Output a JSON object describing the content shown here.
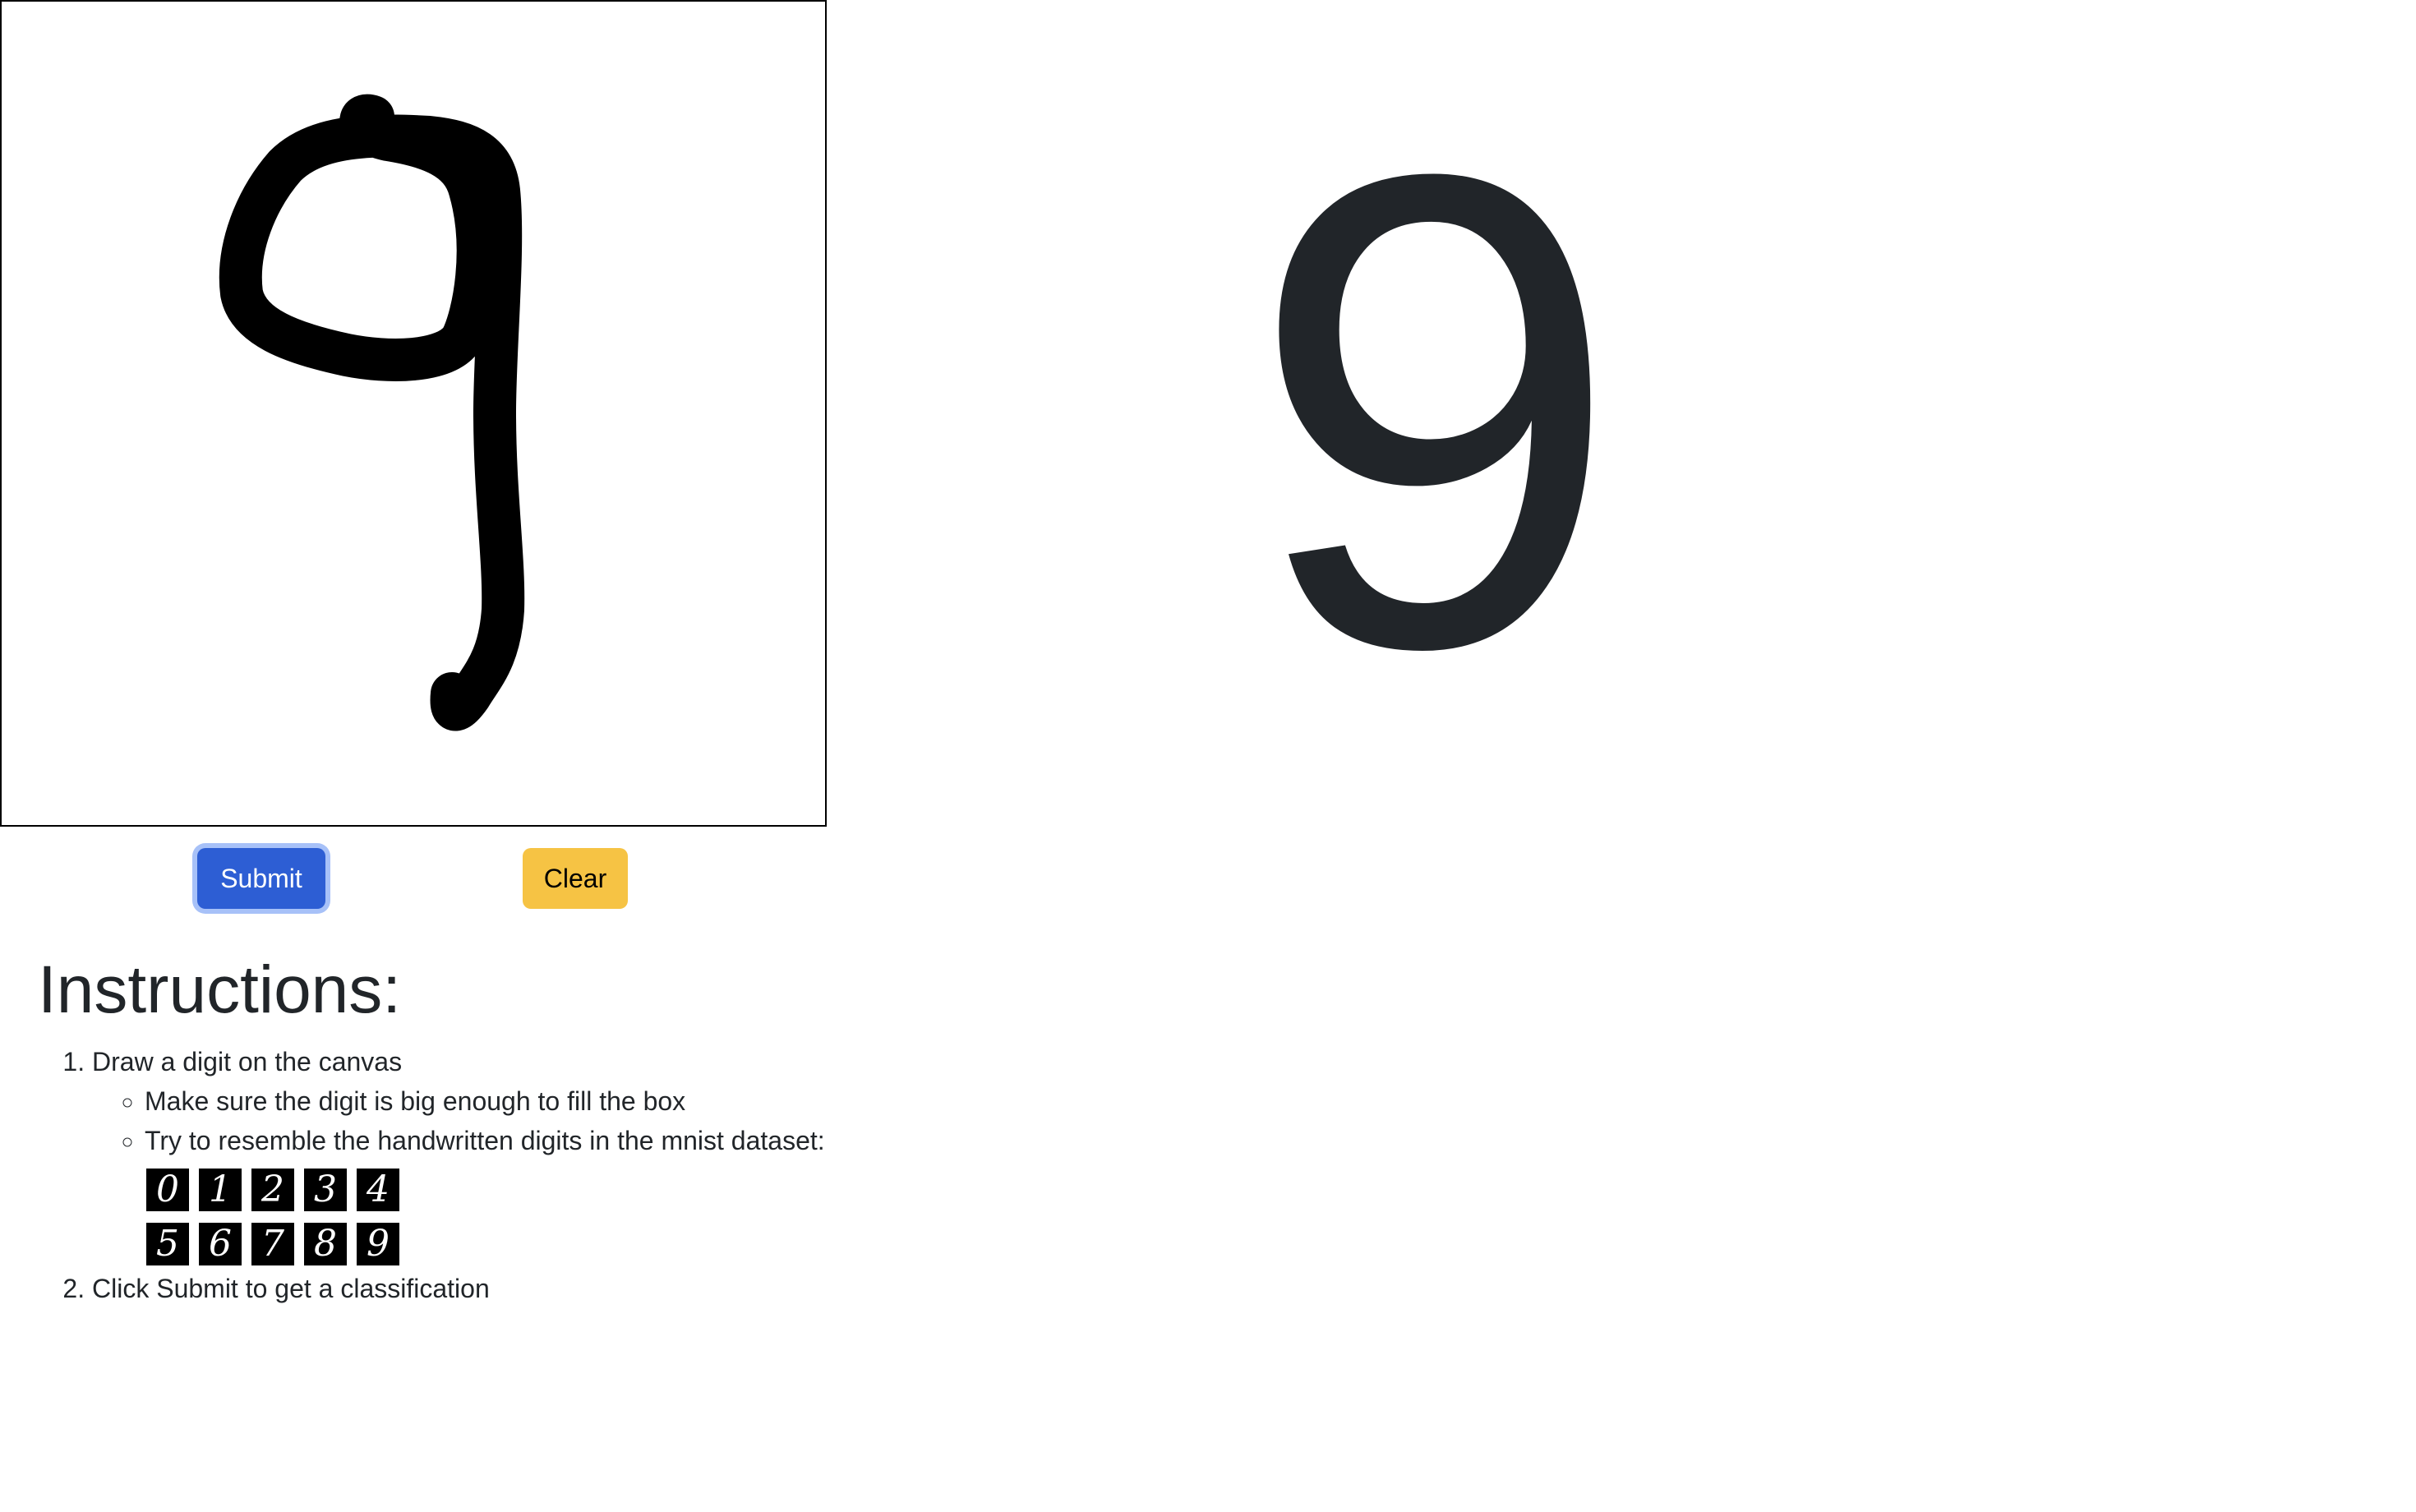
{
  "canvas": {
    "drawn_digit": "9"
  },
  "buttons": {
    "submit_label": "Submit",
    "clear_label": "Clear"
  },
  "prediction": {
    "value": "9"
  },
  "instructions": {
    "title": "Instructions:",
    "step1": "Draw a digit on the canvas",
    "step1_sub": [
      "Make sure the digit is big enough to fill the box",
      "Try to resemble the handwritten digits in the mnist dataset:"
    ],
    "mnist_samples": [
      "0",
      "1",
      "2",
      "3",
      "4",
      "5",
      "6",
      "7",
      "8",
      "9"
    ],
    "step2": "Click Submit to get a classification"
  },
  "colors": {
    "submit_bg": "#2d5ed4",
    "clear_bg": "#f6c344",
    "text": "#212529"
  }
}
